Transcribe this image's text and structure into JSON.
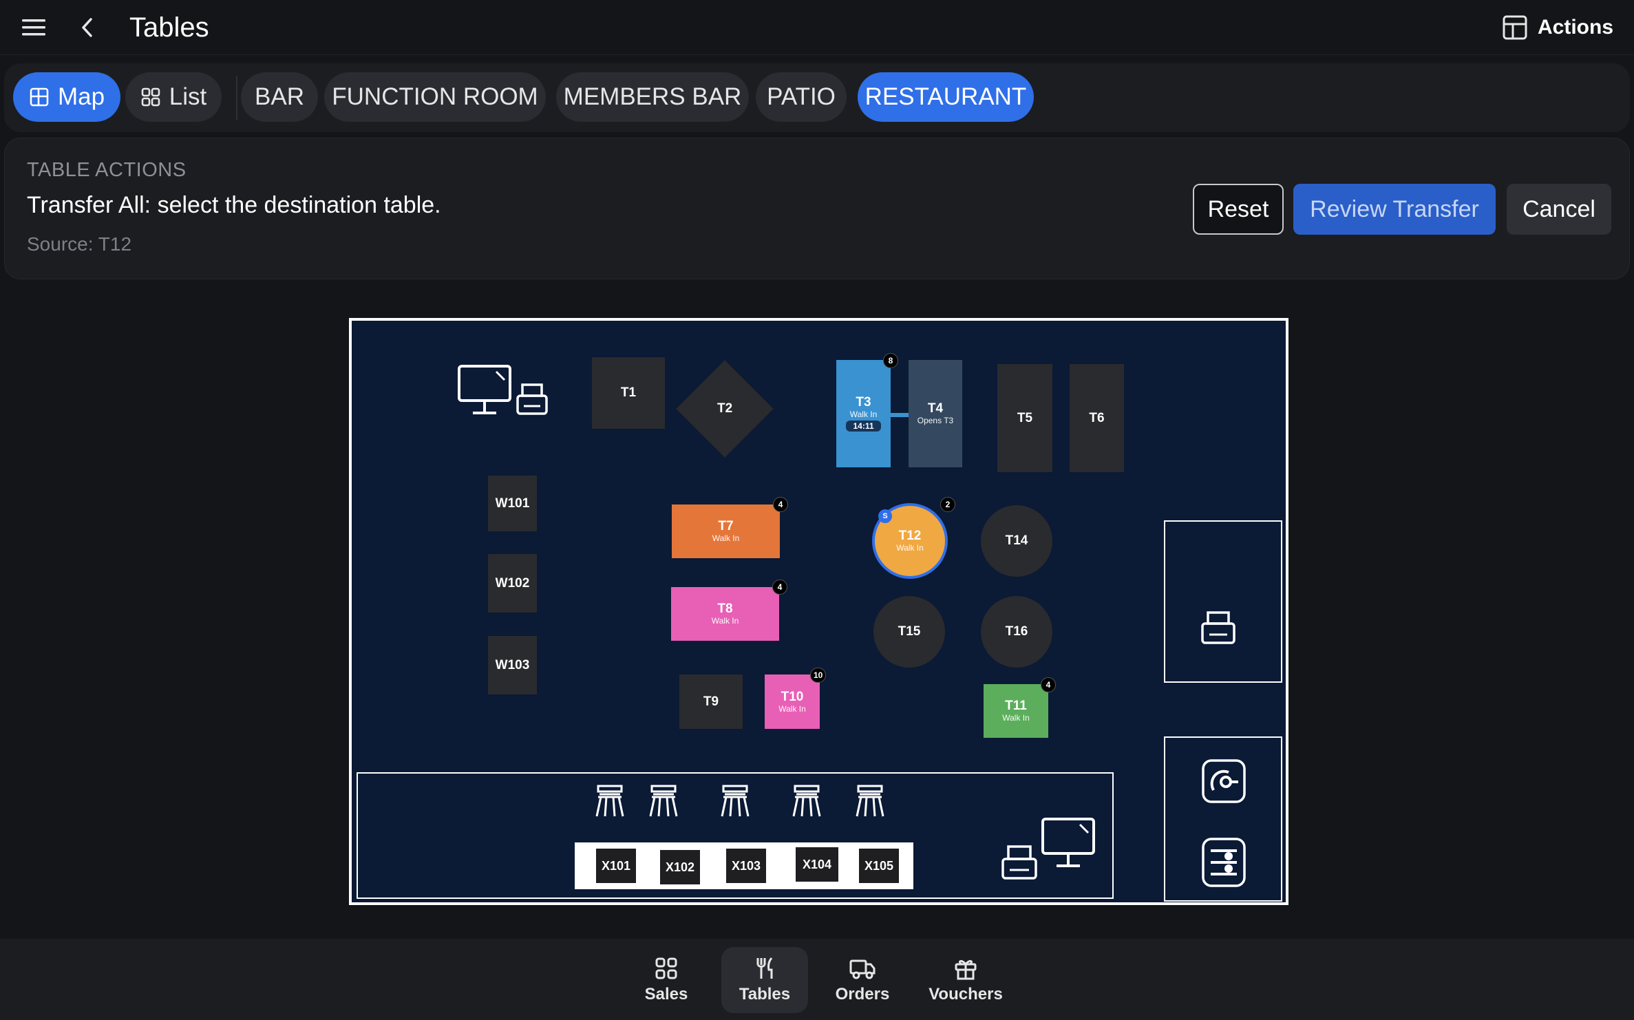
{
  "header": {
    "title": "Tables",
    "actions_label": "Actions"
  },
  "tabs": [
    {
      "label": "Map",
      "icon": "map-icon",
      "active": true
    },
    {
      "label": "List",
      "icon": "grid-icon",
      "active": false
    },
    {
      "label": "BAR",
      "active": false
    },
    {
      "label": "FUNCTION ROOM",
      "active": false
    },
    {
      "label": "MEMBERS BAR",
      "active": false
    },
    {
      "label": "PATIO",
      "active": false
    },
    {
      "label": "RESTAURANT",
      "active": true
    }
  ],
  "table_actions": {
    "heading": "TABLE ACTIONS",
    "instruction": "Transfer All: select the destination table.",
    "source": "Source: T12",
    "reset_label": "Reset",
    "review_label": "Review Transfer",
    "cancel_label": "Cancel"
  },
  "floor": {
    "tables": {
      "T1": {
        "label": "T1"
      },
      "T2": {
        "label": "T2"
      },
      "T3": {
        "label": "T3",
        "sub": "Walk In",
        "time": "14:11",
        "badge": "8",
        "color": "#3a92d0"
      },
      "T4": {
        "label": "T4",
        "sub": "Opens T3",
        "color": "#34495f"
      },
      "T5": {
        "label": "T5"
      },
      "T6": {
        "label": "T6"
      },
      "T7": {
        "label": "T7",
        "sub": "Walk In",
        "badge": "4",
        "color": "#e4763a"
      },
      "T8": {
        "label": "T8",
        "sub": "Walk In",
        "badge": "4",
        "color": "#e85fb6"
      },
      "T9": {
        "label": "T9"
      },
      "T10": {
        "label": "T10",
        "sub": "Walk In",
        "badge": "10",
        "color": "#e85fb6"
      },
      "T11": {
        "label": "T11",
        "sub": "Walk In",
        "badge": "4",
        "color": "#5cae5c"
      },
      "T12": {
        "label": "T12",
        "sub": "Walk In",
        "badge": "2",
        "marker": "S",
        "color": "#f0a843"
      },
      "T14": {
        "label": "T14"
      },
      "T15": {
        "label": "T15"
      },
      "T16": {
        "label": "T16"
      },
      "W101": {
        "label": "W101"
      },
      "W102": {
        "label": "W102"
      },
      "W103": {
        "label": "W103"
      },
      "X101": {
        "label": "X101"
      },
      "X102": {
        "label": "X102"
      },
      "X103": {
        "label": "X103"
      },
      "X104": {
        "label": "X104"
      },
      "X105": {
        "label": "X105"
      }
    },
    "devices": [
      "pos-terminal-icon",
      "printer-icon",
      "bar-stool-icon",
      "contactless-icon",
      "card-reader-icon"
    ]
  },
  "bottom_nav": [
    {
      "label": "Sales",
      "icon": "grid-icon",
      "active": false
    },
    {
      "label": "Tables",
      "icon": "fork-knife-icon",
      "active": true
    },
    {
      "label": "Orders",
      "icon": "truck-icon",
      "active": false
    },
    {
      "label": "Vouchers",
      "icon": "gift-icon",
      "active": false
    }
  ],
  "colors": {
    "accent": "#2f6fe8",
    "background": "#141518",
    "map_background": "#0b1a35",
    "table_default": "#2a2b2e",
    "selected_ring": "#2f6fe8"
  }
}
